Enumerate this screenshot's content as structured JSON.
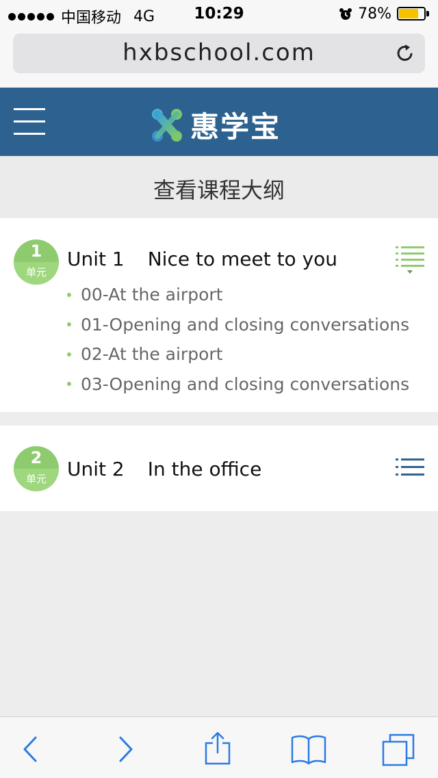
{
  "status_bar": {
    "carrier": "中国移动",
    "network": "4G",
    "time": "10:29",
    "battery": "78%",
    "battery_level": 0.78
  },
  "browser": {
    "url": "hxbschool.com"
  },
  "header": {
    "logo_text": "惠学宝",
    "brand_color": "#2d6190"
  },
  "page": {
    "title": "查看课程大纲"
  },
  "units": [
    {
      "number": "1",
      "badge_label": "单元",
      "unit_label": "Unit 1",
      "name": "Nice to meet to you",
      "expanded": true,
      "lessons": [
        "00-At the airport",
        "01-Opening and closing conversations",
        "02-At the airport",
        "03-Opening and closing conversations"
      ]
    },
    {
      "number": "2",
      "badge_label": "单元",
      "unit_label": "Unit 2",
      "name": "In the office",
      "expanded": false,
      "lessons": []
    }
  ],
  "colors": {
    "accent_green": "#8ecb6f",
    "link_blue": "#2a7ae2"
  }
}
